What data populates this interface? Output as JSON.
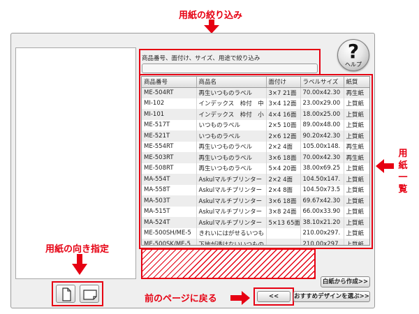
{
  "annotations": {
    "filter": "用紙の絞り込み",
    "list_chars": [
      "用",
      "紙",
      "一",
      "覧"
    ],
    "orientation": "用紙の向き指定",
    "back": "前のページに戻る"
  },
  "filter": {
    "label": "商品番号、面付け、サイズ、用途で絞り込み",
    "value": ""
  },
  "help": {
    "glyph": "?",
    "label": "ヘルプ"
  },
  "table": {
    "headers": [
      "商品番号",
      "商品名",
      "面付け",
      "ラベルサイズ",
      "紙質"
    ],
    "rows": [
      [
        "ME-504RT",
        "再生いつものラベル",
        "3×7 21面",
        "70.00x42.30",
        "再生紙"
      ],
      [
        "MI-102",
        "インデックス　枠付　中",
        "3×4 12面",
        "23.00x29.00",
        "上質紙"
      ],
      [
        "MI-101",
        "インデックス　枠付　小",
        "4×4 16面",
        "18.00x25.00",
        "上質紙"
      ],
      [
        "ME-517T",
        "いつものラベル",
        "2×5 10面",
        "89.00x48.00",
        "上質紙"
      ],
      [
        "ME-521T",
        "いつものラベル",
        "2×6 12面",
        "90.20x42.30",
        "上質紙"
      ],
      [
        "ME-554RT",
        "再生いつものラベル",
        "2×2 4面",
        "105.00x148.",
        "再生紙"
      ],
      [
        "ME-503RT",
        "再生いつものラベル",
        "3×6 18面",
        "70.00x42.30",
        "再生紙"
      ],
      [
        "ME-508RT",
        "再生いつものラベル",
        "5×4 20面",
        "38.00x69.25",
        "上質紙"
      ],
      [
        "MA-554T",
        "Askulマルチプリンター",
        "2×2 4面",
        "104.50x147.",
        "上質紙"
      ],
      [
        "MA-558T",
        "Askulマルチプリンター",
        "2×4 8面",
        "104.50x73.5",
        "上質紙"
      ],
      [
        "MA-503T",
        "Askulマルチプリンター",
        "3×6 18面",
        "69.67x42.30",
        "上質紙"
      ],
      [
        "MA-515T",
        "Askulマルチプリンター",
        "3×8 24面",
        "66.00x33.90",
        "上質紙"
      ],
      [
        "MA-524T",
        "Askulマルチプリンター",
        "5×13 65面",
        "38.10x21.20",
        "上質紙"
      ],
      [
        "ME-500SH/ME-5",
        "きれいにはがせるいつも",
        "",
        "210.00x297.",
        "上質紙"
      ],
      [
        "ME-500SK/ME-5",
        "下地が透けないいつもの",
        "",
        "210.00x297.",
        "上質紙"
      ]
    ]
  },
  "buttons": {
    "blank": "白紙から作成>>",
    "back": "<<",
    "recommend": "おすすめデザインを選ぶ>>"
  },
  "colors": {
    "annotation": "#e60012"
  }
}
